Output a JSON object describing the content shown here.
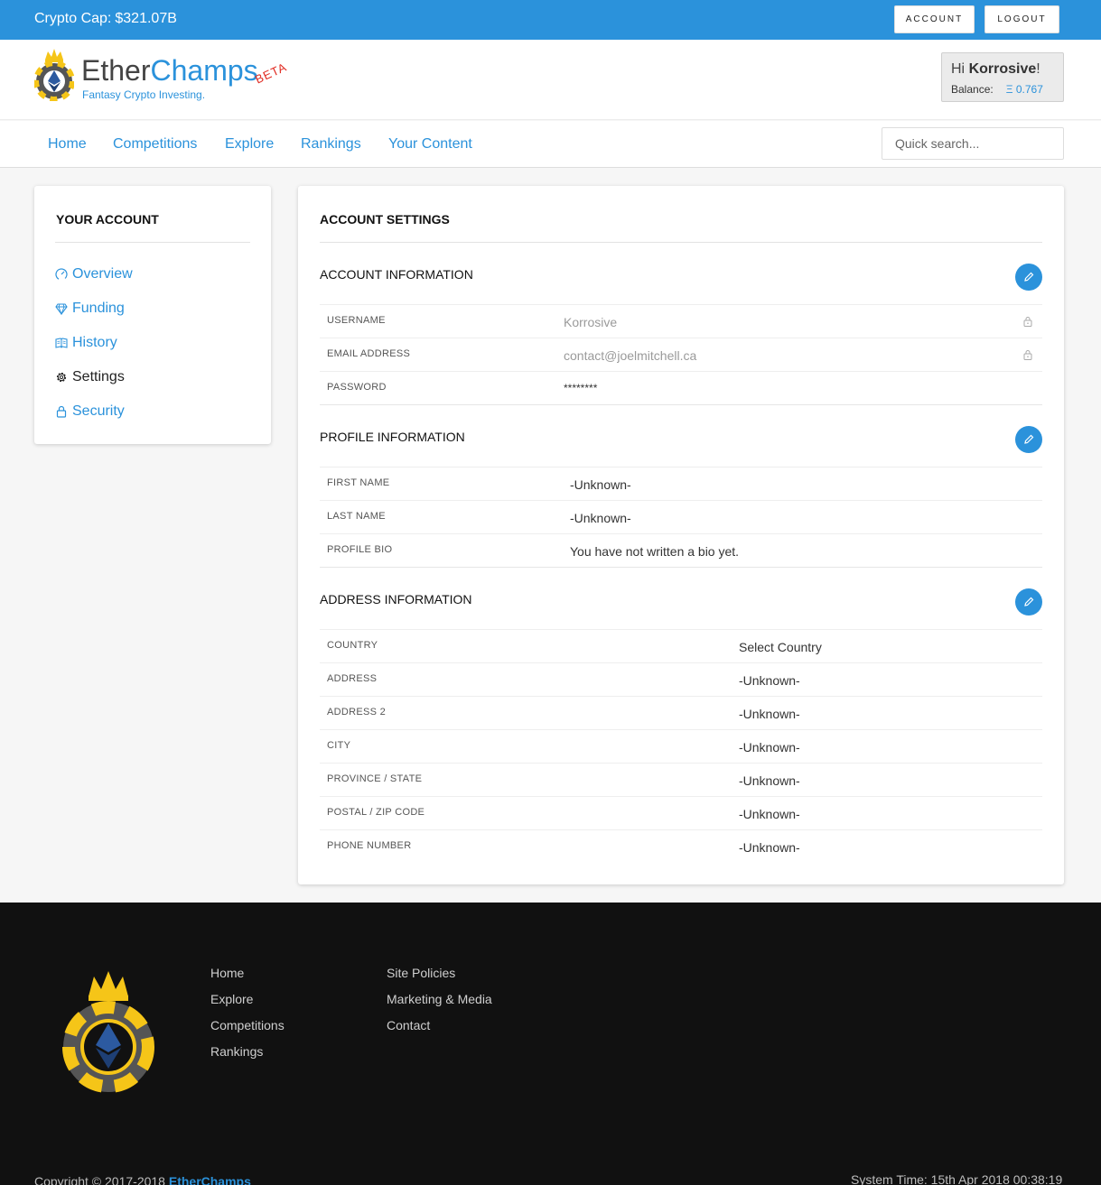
{
  "topbar": {
    "crypto_cap_label": "Crypto Cap:",
    "crypto_cap_value": "$321.07B",
    "account_button": "Account",
    "logout_button": "Logout"
  },
  "header": {
    "brand_part1": "Ether",
    "brand_part2": "Champs",
    "beta": "BETA",
    "tagline": "Fantasy Crypto Investing.",
    "greeting": "Hi",
    "username": "Korrosive",
    "greeting_end": "!",
    "balance_label": "Balance:",
    "balance_value": "Ξ 0.767"
  },
  "nav": {
    "items": [
      "Home",
      "Competitions",
      "Explore",
      "Rankings",
      "Your Content"
    ],
    "search_placeholder": "Quick search..."
  },
  "sidebar": {
    "title": "YOUR ACCOUNT",
    "items": [
      {
        "label": "Overview",
        "icon": "gauge-icon"
      },
      {
        "label": "Funding",
        "icon": "diamond-icon"
      },
      {
        "label": "History",
        "icon": "book-icon"
      },
      {
        "label": "Settings",
        "icon": "gear-icon"
      },
      {
        "label": "Security",
        "icon": "lock-icon"
      }
    ],
    "active": "Settings"
  },
  "settings": {
    "title": "ACCOUNT SETTINGS",
    "account": {
      "title": "ACCOUNT INFORMATION",
      "rows": [
        {
          "label": "USERNAME",
          "value": "Korrosive"
        },
        {
          "label": "EMAIL ADDRESS",
          "value": "contact@joelmitchell.ca"
        },
        {
          "label": "PASSWORD",
          "value": "********"
        }
      ]
    },
    "profile": {
      "title": "PROFILE INFORMATION",
      "rows": [
        {
          "label": "FIRST NAME",
          "value": "-Unknown-"
        },
        {
          "label": "LAST NAME",
          "value": "-Unknown-"
        },
        {
          "label": "PROFILE BIO",
          "value": "You have not written a bio yet."
        }
      ]
    },
    "address": {
      "title": "ADDRESS INFORMATION",
      "rows": [
        {
          "label": "COUNTRY",
          "value": "Select Country"
        },
        {
          "label": "ADDRESS",
          "value": "-Unknown-"
        },
        {
          "label": "ADDRESS 2",
          "value": "-Unknown-"
        },
        {
          "label": "CITY",
          "value": "-Unknown-"
        },
        {
          "label": "PROVINCE / STATE",
          "value": "-Unknown-"
        },
        {
          "label": "POSTAL / ZIP CODE",
          "value": "-Unknown-"
        },
        {
          "label": "PHONE NUMBER",
          "value": "-Unknown-"
        }
      ]
    }
  },
  "footer": {
    "links_col1": [
      "Home",
      "Explore",
      "Competitions",
      "Rankings"
    ],
    "links_col2": [
      "Site Policies",
      "Marketing & Media",
      "Contact"
    ],
    "copyright": "Copyright © 2017-2018",
    "copyright_brand": "EtherChamps",
    "system_time": "System Time: 15th Apr 2018 00:38:19"
  },
  "colors": {
    "accent": "#2b92db",
    "footer_bg": "#111111",
    "beta": "#e0281f"
  }
}
